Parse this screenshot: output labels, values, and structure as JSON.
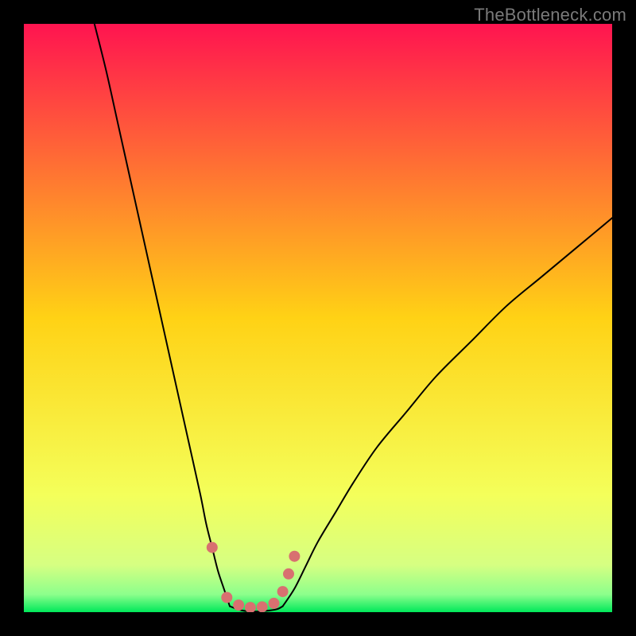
{
  "watermark": "TheBottleneck.com",
  "chart_data": {
    "type": "line",
    "title": "",
    "xlabel": "",
    "ylabel": "",
    "xlim": [
      0,
      100
    ],
    "ylim": [
      0,
      100
    ],
    "grid": false,
    "background": {
      "description": "vertical gradient red-to-green with thin green band at bottom",
      "stops": [
        {
          "offset": 0.0,
          "color": "#ff1450"
        },
        {
          "offset": 0.5,
          "color": "#ffd215"
        },
        {
          "offset": 0.8,
          "color": "#f4ff5a"
        },
        {
          "offset": 0.92,
          "color": "#d6ff82"
        },
        {
          "offset": 0.97,
          "color": "#8cff8c"
        },
        {
          "offset": 1.0,
          "color": "#00e85a"
        }
      ]
    },
    "series": [
      {
        "name": "left-branch",
        "color": "#000000",
        "stroke_width": 2,
        "x": [
          12,
          14,
          16,
          18,
          20,
          22,
          24,
          26,
          28,
          30,
          31,
          32,
          33,
          34,
          35
        ],
        "y": [
          100,
          92,
          83,
          74,
          65,
          56,
          47,
          38,
          29,
          20,
          15,
          11,
          7,
          4,
          1
        ]
      },
      {
        "name": "right-branch",
        "color": "#000000",
        "stroke_width": 2,
        "x": [
          44,
          46,
          48,
          50,
          53,
          56,
          60,
          65,
          70,
          76,
          82,
          88,
          94,
          100
        ],
        "y": [
          1,
          4,
          8,
          12,
          17,
          22,
          28,
          34,
          40,
          46,
          52,
          57,
          62,
          67
        ]
      },
      {
        "name": "valley-floor",
        "color": "#000000",
        "stroke_width": 2,
        "x": [
          35,
          37,
          39,
          41,
          43,
          44
        ],
        "y": [
          1,
          0.3,
          0.1,
          0.2,
          0.5,
          1
        ]
      }
    ],
    "markers": {
      "name": "valley-markers",
      "color": "#d87070",
      "radius": 7,
      "points": [
        {
          "x": 32.0,
          "y": 11.0
        },
        {
          "x": 34.5,
          "y": 2.5
        },
        {
          "x": 36.5,
          "y": 1.2
        },
        {
          "x": 38.5,
          "y": 0.8
        },
        {
          "x": 40.5,
          "y": 0.9
        },
        {
          "x": 42.5,
          "y": 1.5
        },
        {
          "x": 44.0,
          "y": 3.5
        },
        {
          "x": 45.0,
          "y": 6.5
        },
        {
          "x": 46.0,
          "y": 9.5
        }
      ]
    }
  }
}
